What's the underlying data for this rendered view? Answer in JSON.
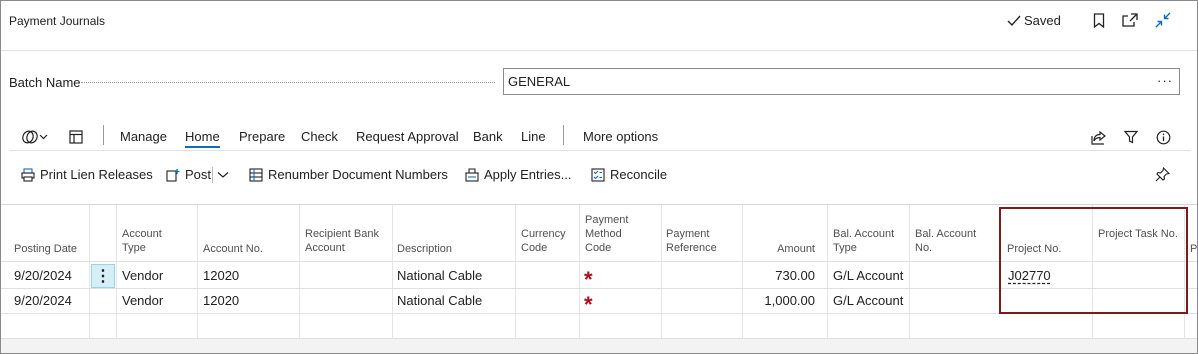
{
  "header": {
    "title": "Payment Journals",
    "saved_label": "Saved"
  },
  "batch": {
    "label": "Batch Name",
    "value": "GENERAL",
    "lookup": "···"
  },
  "action_bar": {
    "items": [
      "Manage",
      "Home",
      "Prepare",
      "Check",
      "Request Approval",
      "Bank",
      "Line",
      "More options"
    ],
    "active": "Home"
  },
  "sub_actions": {
    "print_lien": "Print Lien Releases",
    "post": "Post",
    "renumber": "Renumber Document Numbers",
    "apply": "Apply Entries...",
    "reconcile": "Reconcile"
  },
  "columns": {
    "posting_date": "Posting Date",
    "account_type": "Account Type",
    "account_no": "Account No.",
    "recipient_bank": "Recipient Bank Account",
    "description": "Description",
    "currency": "Currency Code",
    "payment_method": "Payment Method Code",
    "payment_ref": "Payment Reference",
    "amount": "Amount",
    "bal_type": "Bal. Account Type",
    "bal_no": "Bal. Account No.",
    "project_no": "Project No.",
    "project_task": "Project Task No.",
    "cut_off": "P"
  },
  "rows": [
    {
      "posting_date": "9/20/2024",
      "account_type": "Vendor",
      "account_no": "12020",
      "description": "National Cable",
      "payment_method_required": "*",
      "amount": "730.00",
      "bal_type": "G/L Account",
      "project_no": "J02770"
    },
    {
      "posting_date": "9/20/2024",
      "account_type": "Vendor",
      "account_no": "12020",
      "description": "National Cable",
      "payment_method_required": "*",
      "amount": "1,000.00",
      "bal_type": "G/L Account",
      "project_no": ""
    }
  ],
  "colors": {
    "accent": "#0f6cbd",
    "required": "#b10e1c",
    "highlight_border": "#7a1c1c",
    "selected_cell": "#d6eef5"
  }
}
